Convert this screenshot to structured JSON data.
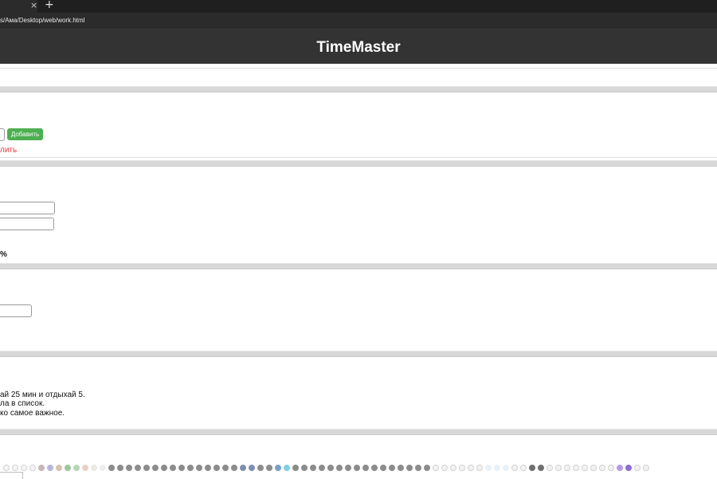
{
  "browser": {
    "tab_close_glyph": "×",
    "new_tab_glyph": "+",
    "address": "s/Ама/Desktop/web/work.html"
  },
  "header": {
    "title": "TimeMaster"
  },
  "tasks": {
    "add_button": "Добавить",
    "delete_link_fragment": "лить"
  },
  "stats": {
    "percent_fragment": "%"
  },
  "tips": {
    "line1": "ай 25 мин и отдыхай 5.",
    "line2": "ла в список.",
    "line3": "ко самое важное."
  },
  "colors": {
    "header_bg": "#333333",
    "add_button": "#4caf50",
    "delete_link": "#e53935"
  },
  "footer_dots": [
    "#f5f5f5",
    "#f5f5f5",
    "#f5f5f5",
    "#f5f5f5",
    "#c9b7b7",
    "#b7b7d6",
    "#d8c2b0",
    "#9ec69e",
    "#b6d6b6",
    "#e8d0c8",
    "#eceae2",
    "#ededed",
    "#8c8c8c",
    "#8c8c8c",
    "#8c8c8c",
    "#8c8c8c",
    "#8c8c8c",
    "#8c8c8c",
    "#8c8c8c",
    "#8c8c8c",
    "#8c8c8c",
    "#8c8c8c",
    "#8c8c8c",
    "#8c8c8c",
    "#8c8c8c",
    "#8c8c8c",
    "#8c8c8c",
    "#7f8fb0",
    "#7f8fb0",
    "#8c8c8c",
    "#8c8c8c",
    "#7aa2c8",
    "#80d0e8",
    "#8c8c8c",
    "#8c8c8c",
    "#8c8c8c",
    "#8c8c8c",
    "#8c8c8c",
    "#8c8c8c",
    "#8c8c8c",
    "#8c8c8c",
    "#8c8c8c",
    "#8c8c8c",
    "#8c8c8c",
    "#8c8c8c",
    "#8c8c8c",
    "#8c8c8c",
    "#8c8c8c",
    "#8c8c8c",
    "#f3f3f3",
    "#f3f3f3",
    "#f3f3f3",
    "#f3f3f3",
    "#f3f3f3",
    "#f3f3f3",
    "#e8f1f8",
    "#e8f1f8",
    "#e8f1f8",
    "#f3f3f3",
    "#f3f3f3",
    "#707070",
    "#707070",
    "#f3f3f3",
    "#f3f3f3",
    "#f3f3f3",
    "#f3f3f3",
    "#f3f3f3",
    "#f3f3f3",
    "#f3f3f3",
    "#f3f3f3",
    "#b59ce6",
    "#8a6fd6",
    "#f3f3f3",
    "#f3f3f3"
  ]
}
